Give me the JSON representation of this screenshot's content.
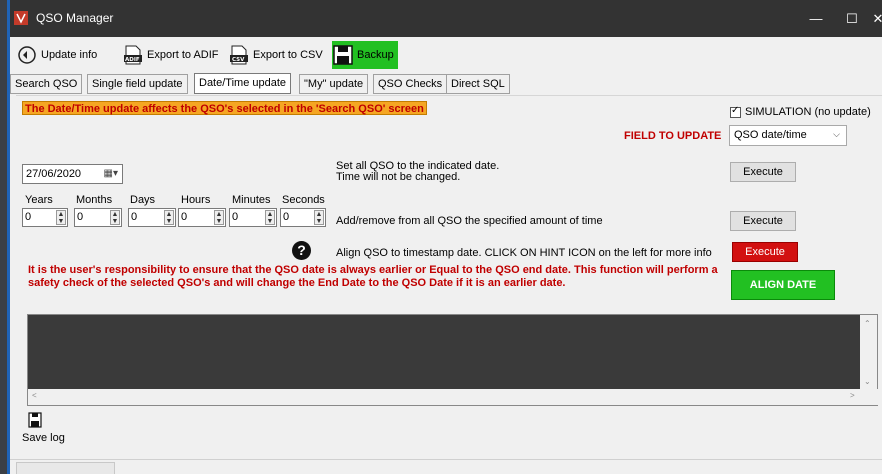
{
  "window": {
    "title": "QSO Manager",
    "minimize": "—",
    "maximize": "☐",
    "close": "✕"
  },
  "toolbar": {
    "update_info": "Update info",
    "export_adif": "Export to ADIF",
    "export_csv": "Export to CSV",
    "backup": "Backup",
    "backup_color": "#22c022"
  },
  "tabs": [
    {
      "label": "Search QSO",
      "active": false
    },
    {
      "label": "Single field update",
      "active": false
    },
    {
      "label": "Date/Time update",
      "active": true
    },
    {
      "label": "\"My\" update",
      "active": false
    },
    {
      "label": "QSO Checks",
      "active": false
    },
    {
      "label": "Direct SQL",
      "active": false
    }
  ],
  "panel": {
    "notice": "The Date/Time update affects the QSO's selected in the 'Search QSO' screen",
    "simulation_label": "SIMULATION (no update)",
    "simulation_checked": true,
    "field_label": "FIELD TO UPDATE",
    "field_value": "QSO date/time",
    "date_value": "27/06/2020",
    "set_date_line1": "Set all QSO to the indicated date.",
    "set_date_line2": "Time will not be changed.",
    "execute_label": "Execute",
    "units": [
      {
        "label": "Years",
        "value": "0"
      },
      {
        "label": "Months",
        "value": "0"
      },
      {
        "label": "Days",
        "value": "0"
      },
      {
        "label": "Hours",
        "value": "0"
      },
      {
        "label": "Minutes",
        "value": "0"
      },
      {
        "label": "Seconds",
        "value": "0"
      }
    ],
    "add_remove_text": "Add/remove from all QSO the specified amount of time",
    "align_text": "Align QSO to timestamp date. CLICK ON HINT ICON on the left for more info",
    "help_icon_glyph": "?",
    "warning": "It is the user's responsibility to ensure that the QSO date is always earlier or Equal to the QSO end date. This function will perform a safety check of the selected QSO's and will change the End Date to the QSO Date if it is an earlier date.",
    "align_date_label": "ALIGN DATE",
    "accent_red": "#c00000",
    "accent_green": "#22c022",
    "notice_bg": "#f5a623"
  },
  "log": {
    "save_label": "Save log"
  },
  "icons": {
    "app": "app-icon",
    "update_info": "refresh-icon",
    "adif": "adif-file-icon",
    "csv": "csv-file-icon",
    "backup": "floppy-disk-icon",
    "save_log": "floppy-disk-icon"
  }
}
